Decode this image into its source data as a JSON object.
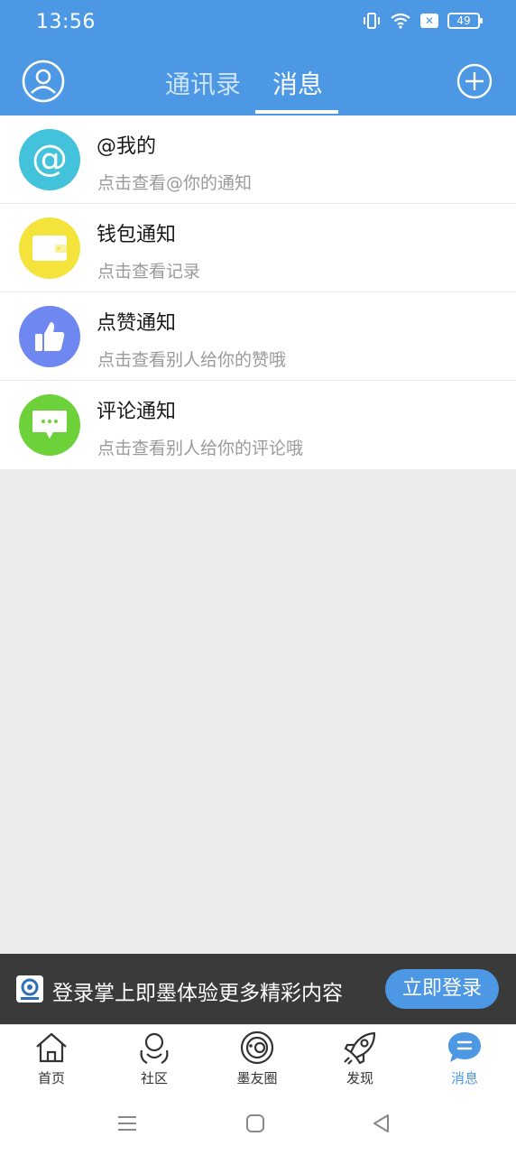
{
  "status": {
    "time": "13:56",
    "battery": "49"
  },
  "header": {
    "tabs": [
      {
        "label": "通讯录",
        "active": false
      },
      {
        "label": "消息",
        "active": true
      }
    ]
  },
  "list": [
    {
      "title": "@我的",
      "subtitle": "点击查看@你的通知",
      "icon": "at-icon",
      "color": "#43c2dc"
    },
    {
      "title": "钱包通知",
      "subtitle": "点击查看记录",
      "icon": "wallet-icon",
      "color": "#f3e33b"
    },
    {
      "title": "点赞通知",
      "subtitle": "点击查看别人给你的赞哦",
      "icon": "thumbs-up-icon",
      "color": "#6f87f0"
    },
    {
      "title": "评论通知",
      "subtitle": "点击查看别人给你的评论哦",
      "icon": "comment-icon",
      "color": "#6dd23a"
    }
  ],
  "banner": {
    "text": "登录掌上即墨体验更多精彩内容",
    "button": "立即登录"
  },
  "tabbar": [
    {
      "label": "首页",
      "icon": "home-icon"
    },
    {
      "label": "社区",
      "icon": "community-icon"
    },
    {
      "label": "墨友圈",
      "icon": "moyou-circle-icon"
    },
    {
      "label": "发现",
      "icon": "rocket-icon"
    },
    {
      "label": "消息",
      "icon": "message-icon",
      "active": true
    }
  ],
  "colors": {
    "accent": "#4c98e4"
  }
}
